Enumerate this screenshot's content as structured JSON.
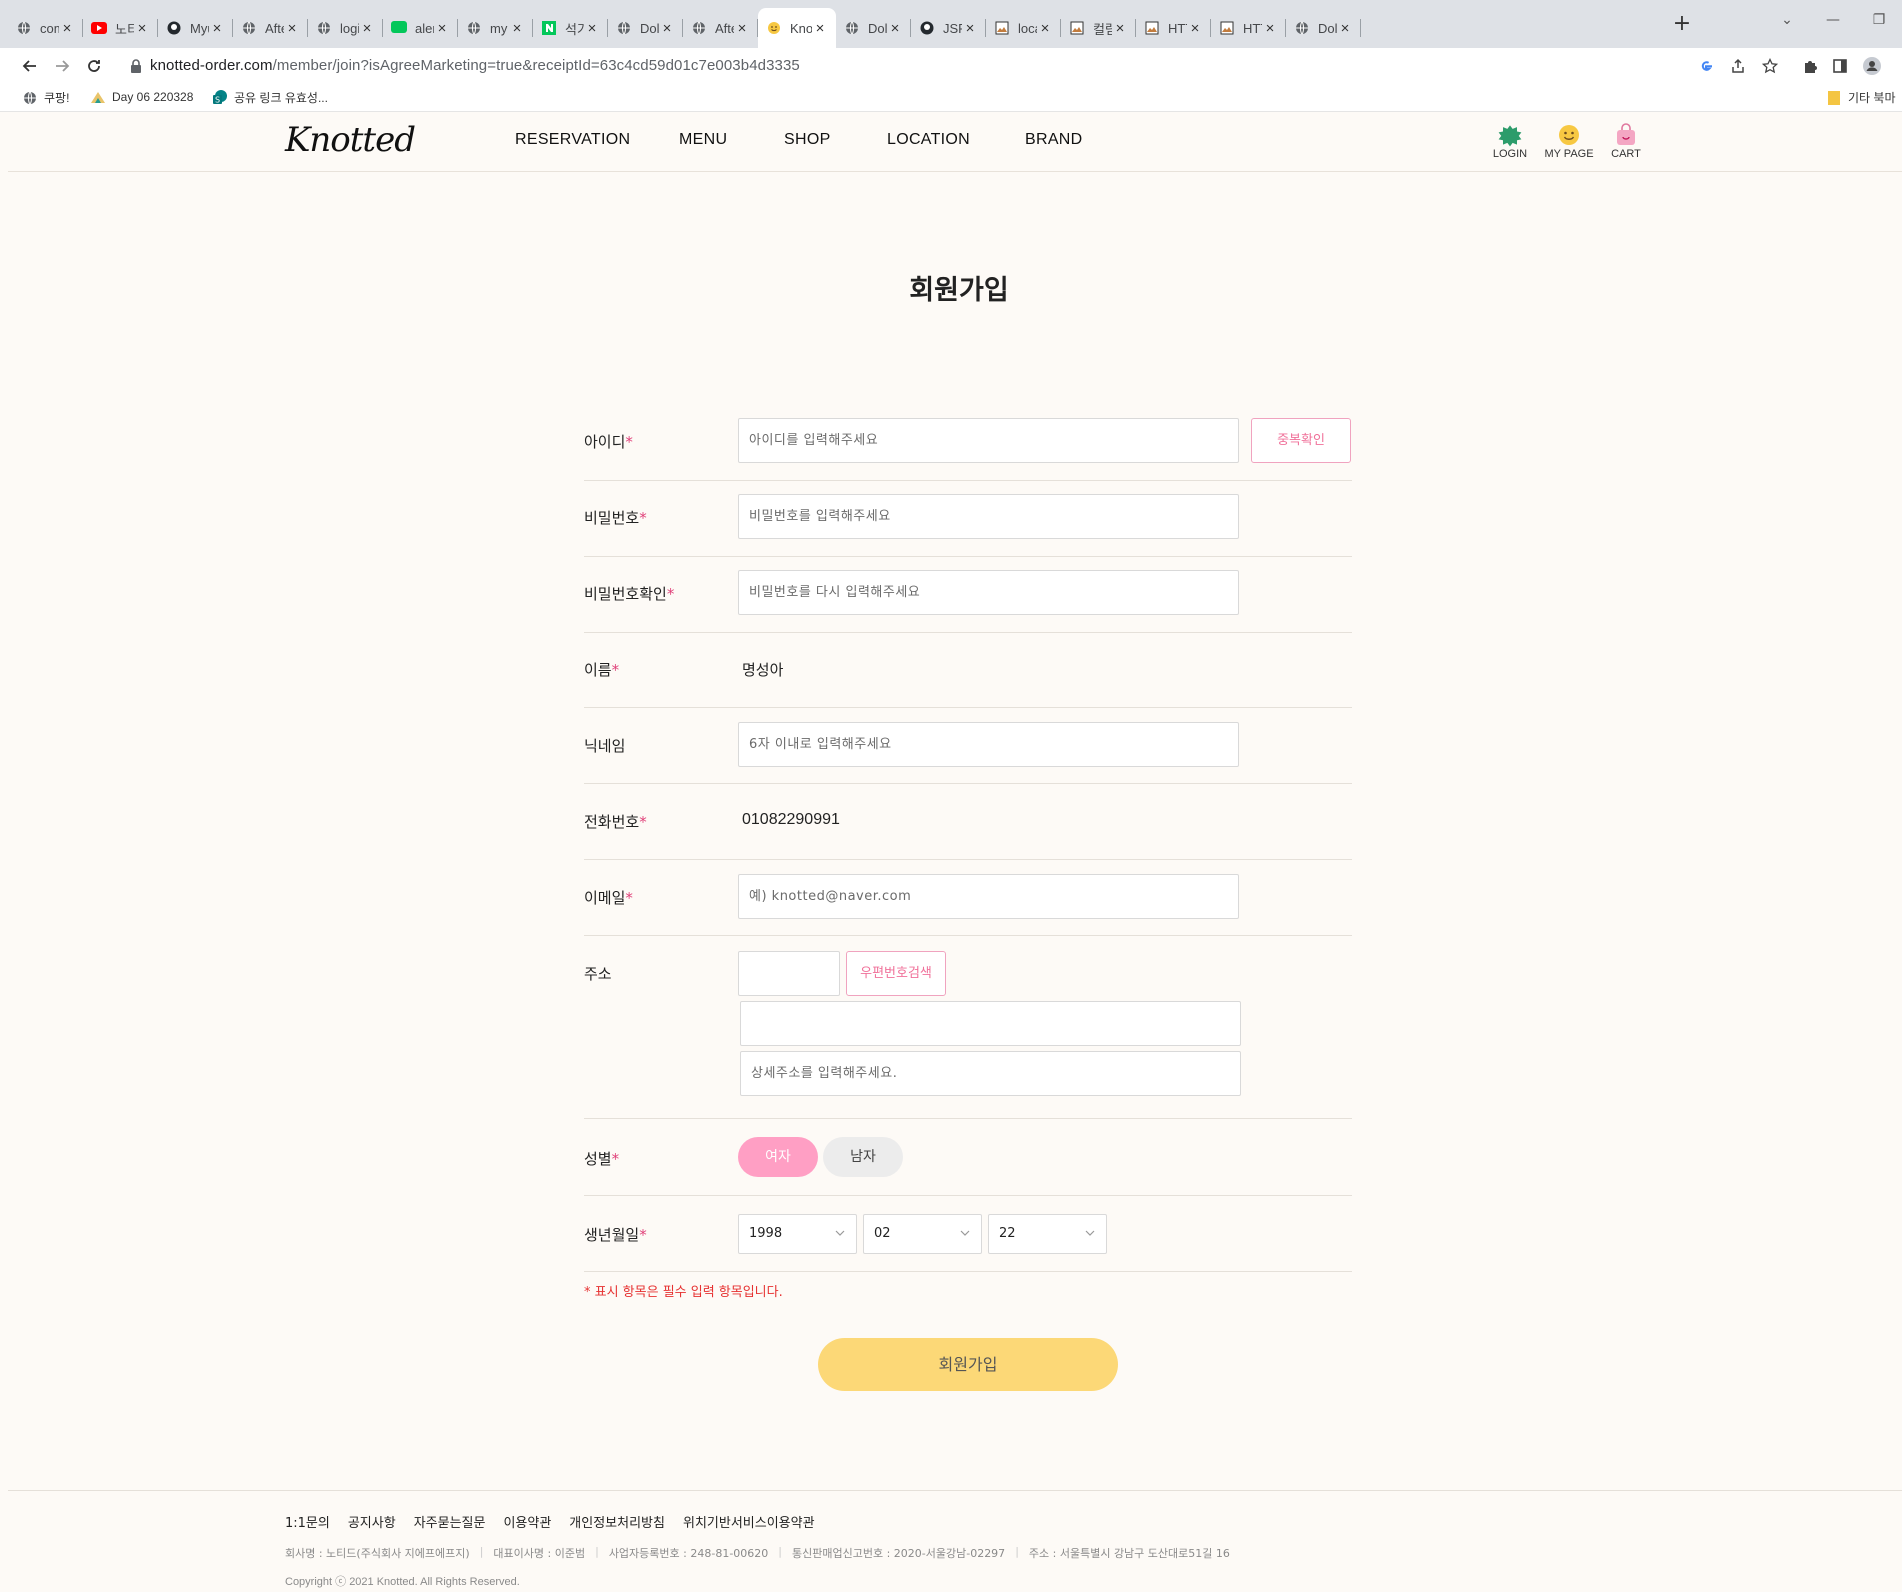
{
  "browser": {
    "tabs": [
      {
        "title": "com",
        "icon": "globe-icon",
        "active": false
      },
      {
        "title": "노티",
        "icon": "youtube-icon",
        "active": false
      },
      {
        "title": "Myu",
        "icon": "github-icon",
        "active": false
      },
      {
        "title": "Afte",
        "icon": "globe-icon",
        "active": false
      },
      {
        "title": "login",
        "icon": "globe-icon",
        "active": false
      },
      {
        "title": "alert",
        "icon": "naver-talk-icon",
        "active": false
      },
      {
        "title": "my p",
        "icon": "globe-icon",
        "active": false
      },
      {
        "title": "석가",
        "icon": "naver-icon",
        "active": false
      },
      {
        "title": "Dolc",
        "icon": "globe-icon",
        "active": false
      },
      {
        "title": "Afte",
        "icon": "globe-icon",
        "active": false
      },
      {
        "title": "Knot",
        "icon": "smiley-icon",
        "active": true
      },
      {
        "title": "Dolc",
        "icon": "globe-icon",
        "active": false
      },
      {
        "title": "JSPS",
        "icon": "github-icon",
        "active": false
      },
      {
        "title": "locall",
        "icon": "image-icon",
        "active": false
      },
      {
        "title": "컬럼",
        "icon": "image-icon",
        "active": false
      },
      {
        "title": "HTTF",
        "icon": "image-icon",
        "active": false
      },
      {
        "title": "HTTF",
        "icon": "image-icon",
        "active": false
      },
      {
        "title": "Dolc",
        "icon": "globe-icon",
        "active": false
      }
    ],
    "new_tab": "+",
    "url_host": "knotted-order.com",
    "url_path": "/member/join?isAgreeMarketing=true&receiptId=63c4cd59d01c7e003b4d3335",
    "bookmarks": [
      {
        "label": "쿠팡!",
        "icon": "globe-icon"
      },
      {
        "label": "Day 06 220328",
        "icon": "bookmark-icon"
      },
      {
        "label": "공유 링크 유효성...",
        "icon": "sharepoint-icon"
      }
    ],
    "bookmarks_other": "기타 북마"
  },
  "site": {
    "logo": "Knotted",
    "nav": [
      "RESERVATION",
      "MENU",
      "SHOP",
      "LOCATION",
      "BRAND"
    ],
    "util": [
      {
        "label": "LOGIN",
        "icon": "login-badge-icon"
      },
      {
        "label": "MY PAGE",
        "icon": "smiley-icon"
      },
      {
        "label": "CART",
        "icon": "cart-icon"
      }
    ]
  },
  "form": {
    "title": "회원가입",
    "required_mark": "*",
    "id_label": "아이디",
    "id_placeholder": "아이디를 입력해주세요",
    "id_check_button": "중복확인",
    "password_label": "비밀번호",
    "password_placeholder": "비밀번호를 입력해주세요",
    "password_confirm_label": "비밀번호확인",
    "password_confirm_placeholder": "비밀번호를 다시 입력해주세요",
    "name_label": "이름",
    "name_value": "명성아",
    "nickname_label": "닉네임",
    "nickname_placeholder": "6자 이내로 입력해주세요",
    "phone_label": "전화번호",
    "phone_value": "01082290991",
    "email_label": "이메일",
    "email_placeholder": "예) knotted@naver.com",
    "address_label": "주소",
    "zipcode_button": "우편번호검색",
    "address_detail_placeholder": "상세주소를 입력해주세요.",
    "gender_label": "성별",
    "gender_female": "여자",
    "gender_male": "남자",
    "birth_label": "생년월일",
    "birth_year": "1998",
    "birth_month": "02",
    "birth_day": "22",
    "notice": "* 표시 항목은 필수 입력 항목입니다.",
    "submit": "회원가입"
  },
  "footer": {
    "links": [
      "1:1문의",
      "공지사항",
      "자주묻는질문",
      "이용약관",
      "개인정보처리방침",
      "위치기반서비스이용약관"
    ],
    "info": [
      "회사명 : 노티드(주식회사 지에프에프지)",
      "대표이사명 : 이준범",
      "사업자등록번호 : 248-81-00620",
      "통신판매업신고번호 : 2020-서울강남-02297",
      "주소 : 서울특별시 강남구 도산대로51길 16"
    ],
    "copyright": "Copyright ⓒ 2021 Knotted. All Rights Reserved."
  },
  "colors": {
    "accent_pink": "#f0719a",
    "gender_selected": "#ff9fc4",
    "submit_yellow": "#fcd877",
    "required_red": "#e63131",
    "page_bg": "#fdfaf6"
  }
}
